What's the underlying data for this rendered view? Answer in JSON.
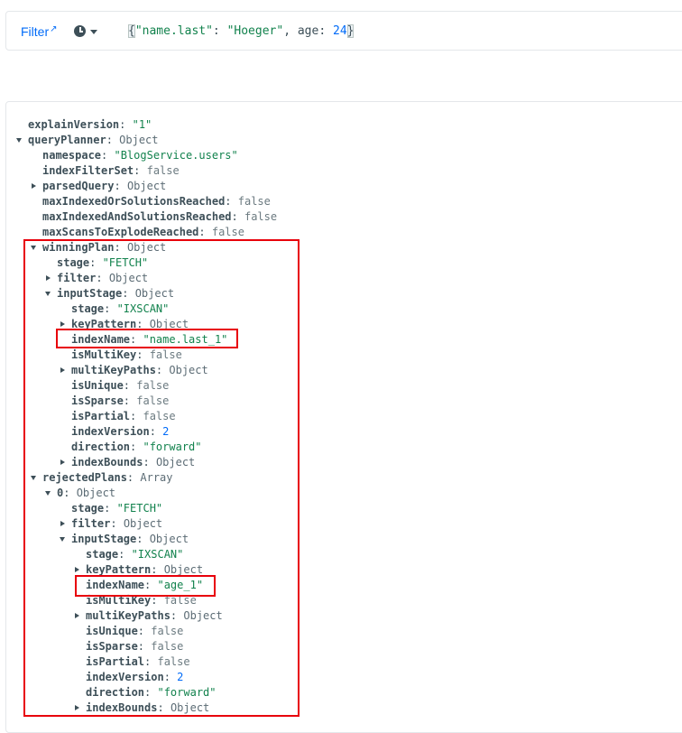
{
  "filter_bar": {
    "filter_label": "Filter",
    "query_text": "{\"name.last\": \"Hoeger\", age: 24}"
  },
  "tree": [
    {
      "key": "explainVersion",
      "sep": ": ",
      "value": "\"1\"",
      "type": "str",
      "depth": 0,
      "toggle": "none"
    },
    {
      "key": "queryPlanner",
      "sep": ": ",
      "value": "Object",
      "type": "type",
      "depth": 0,
      "toggle": "down"
    },
    {
      "key": "namespace",
      "sep": ": ",
      "value": "\"BlogService.users\"",
      "type": "str",
      "depth": 1,
      "toggle": "none"
    },
    {
      "key": "indexFilterSet",
      "sep": ": ",
      "value": "false",
      "type": "bool",
      "depth": 1,
      "toggle": "none"
    },
    {
      "key": "parsedQuery",
      "sep": ": ",
      "value": "Object",
      "type": "type",
      "depth": 1,
      "toggle": "right"
    },
    {
      "key": "maxIndexedOrSolutionsReached",
      "sep": ": ",
      "value": "false",
      "type": "bool",
      "depth": 1,
      "toggle": "none"
    },
    {
      "key": "maxIndexedAndSolutionsReached",
      "sep": ": ",
      "value": "false",
      "type": "bool",
      "depth": 1,
      "toggle": "none"
    },
    {
      "key": "maxScansToExplodeReached",
      "sep": ": ",
      "value": "false",
      "type": "bool",
      "depth": 1,
      "toggle": "none"
    },
    {
      "key": "winningPlan",
      "sep": ": ",
      "value": "Object",
      "type": "type",
      "depth": 1,
      "toggle": "down"
    },
    {
      "key": "stage",
      "sep": ": ",
      "value": "\"FETCH\"",
      "type": "str",
      "depth": 2,
      "toggle": "none"
    },
    {
      "key": "filter",
      "sep": ": ",
      "value": "Object",
      "type": "type",
      "depth": 2,
      "toggle": "right"
    },
    {
      "key": "inputStage",
      "sep": ": ",
      "value": "Object",
      "type": "type",
      "depth": 2,
      "toggle": "down"
    },
    {
      "key": "stage",
      "sep": ": ",
      "value": "\"IXSCAN\"",
      "type": "str",
      "depth": 3,
      "toggle": "none"
    },
    {
      "key": "keyPattern",
      "sep": ": ",
      "value": "Object",
      "type": "type",
      "depth": 3,
      "toggle": "right"
    },
    {
      "key": "indexName",
      "sep": ": ",
      "value": "\"name.last_1\"",
      "type": "str",
      "depth": 3,
      "toggle": "none"
    },
    {
      "key": "isMultiKey",
      "sep": ": ",
      "value": "false",
      "type": "bool",
      "depth": 3,
      "toggle": "none"
    },
    {
      "key": "multiKeyPaths",
      "sep": ": ",
      "value": "Object",
      "type": "type",
      "depth": 3,
      "toggle": "right"
    },
    {
      "key": "isUnique",
      "sep": ": ",
      "value": "false",
      "type": "bool",
      "depth": 3,
      "toggle": "none"
    },
    {
      "key": "isSparse",
      "sep": ": ",
      "value": "false",
      "type": "bool",
      "depth": 3,
      "toggle": "none"
    },
    {
      "key": "isPartial",
      "sep": ": ",
      "value": "false",
      "type": "bool",
      "depth": 3,
      "toggle": "none"
    },
    {
      "key": "indexVersion",
      "sep": ": ",
      "value": "2",
      "type": "num",
      "depth": 3,
      "toggle": "none"
    },
    {
      "key": "direction",
      "sep": ": ",
      "value": "\"forward\"",
      "type": "str",
      "depth": 3,
      "toggle": "none"
    },
    {
      "key": "indexBounds",
      "sep": ": ",
      "value": "Object",
      "type": "type",
      "depth": 3,
      "toggle": "right"
    },
    {
      "key": "rejectedPlans",
      "sep": ": ",
      "value": "Array",
      "type": "type",
      "depth": 1,
      "toggle": "down"
    },
    {
      "key": "0",
      "sep": ": ",
      "value": "Object",
      "type": "type",
      "depth": 2,
      "toggle": "down"
    },
    {
      "key": "stage",
      "sep": ": ",
      "value": "\"FETCH\"",
      "type": "str",
      "depth": 3,
      "toggle": "none"
    },
    {
      "key": "filter",
      "sep": ": ",
      "value": "Object",
      "type": "type",
      "depth": 3,
      "toggle": "right"
    },
    {
      "key": "inputStage",
      "sep": ": ",
      "value": "Object",
      "type": "type",
      "depth": 3,
      "toggle": "down"
    },
    {
      "key": "stage",
      "sep": ": ",
      "value": "\"IXSCAN\"",
      "type": "str",
      "depth": 4,
      "toggle": "none"
    },
    {
      "key": "keyPattern",
      "sep": ": ",
      "value": "Object",
      "type": "type",
      "depth": 4,
      "toggle": "right"
    },
    {
      "key": "indexName",
      "sep": ": ",
      "value": "\"age_1\"",
      "type": "str",
      "depth": 4,
      "toggle": "none"
    },
    {
      "key": "isMultiKey",
      "sep": ": ",
      "value": "false",
      "type": "bool",
      "depth": 4,
      "toggle": "none"
    },
    {
      "key": "multiKeyPaths",
      "sep": ": ",
      "value": "Object",
      "type": "type",
      "depth": 4,
      "toggle": "right"
    },
    {
      "key": "isUnique",
      "sep": ": ",
      "value": "false",
      "type": "bool",
      "depth": 4,
      "toggle": "none"
    },
    {
      "key": "isSparse",
      "sep": ": ",
      "value": "false",
      "type": "bool",
      "depth": 4,
      "toggle": "none"
    },
    {
      "key": "isPartial",
      "sep": ": ",
      "value": "false",
      "type": "bool",
      "depth": 4,
      "toggle": "none"
    },
    {
      "key": "indexVersion",
      "sep": ": ",
      "value": "2",
      "type": "num",
      "depth": 4,
      "toggle": "none"
    },
    {
      "key": "direction",
      "sep": ": ",
      "value": "\"forward\"",
      "type": "str",
      "depth": 4,
      "toggle": "none"
    },
    {
      "key": "indexBounds",
      "sep": ": ",
      "value": "Object",
      "type": "type",
      "depth": 4,
      "toggle": "right"
    }
  ]
}
